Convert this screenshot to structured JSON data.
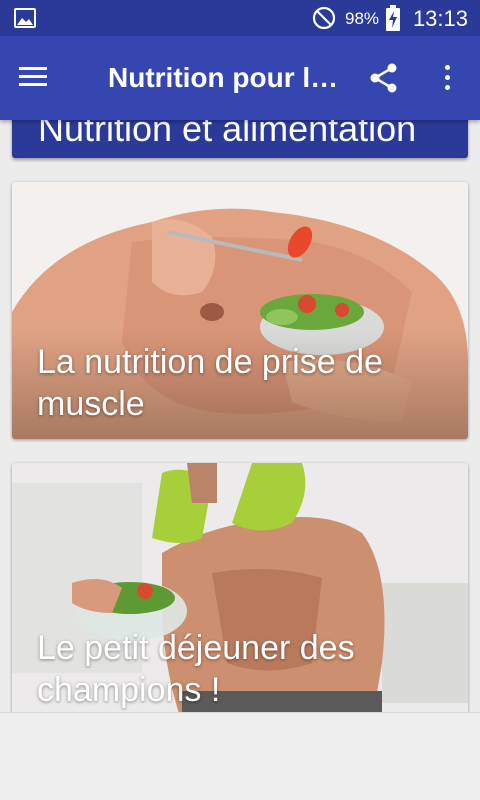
{
  "status_bar": {
    "battery_percent": "98%",
    "time": "13:13",
    "icons": [
      "image-notification-icon",
      "do-not-disturb-icon",
      "battery-charging-icon"
    ]
  },
  "app_bar": {
    "title": "Nutrition pour l…",
    "icons": [
      "menu-icon",
      "share-icon",
      "more-vert-icon"
    ],
    "color": "#3546b0"
  },
  "section": {
    "title": "Nutrition et alimentation"
  },
  "cards": [
    {
      "caption": "La nutrition de prise de muscle"
    },
    {
      "caption": "Le petit déjeuner des champions !"
    }
  ],
  "colors": {
    "status_bar": "#2b3a98",
    "app_bar": "#3546b0",
    "background": "#ececec"
  }
}
